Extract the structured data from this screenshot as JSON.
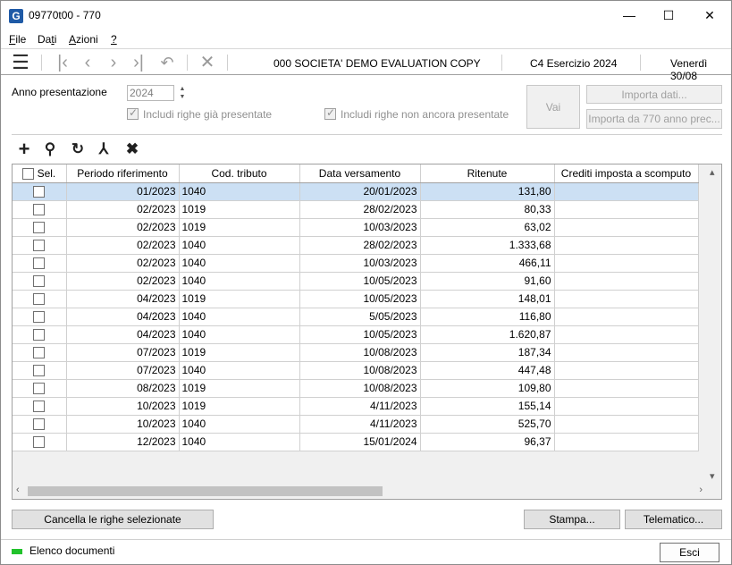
{
  "window": {
    "title": "09770t00 - 770",
    "app_icon_letter": "G",
    "controls": {
      "minimize": "—",
      "maximize": "☐",
      "close": "✕"
    }
  },
  "menu": {
    "items": [
      {
        "label": "File",
        "mnemonic": "F"
      },
      {
        "label": "Dati",
        "mnemonic": "t"
      },
      {
        "label": "Azioni",
        "mnemonic": "A"
      },
      {
        "label": "?",
        "mnemonic": "?"
      }
    ]
  },
  "toolbar": {
    "company": "000 SOCIETA'  DEMO EVALUATION COPY",
    "year": "C4 Esercizio 2024",
    "date": "Venerdì 30/08"
  },
  "form": {
    "anno_label": "Anno presentazione",
    "anno_value": "2024",
    "chk_gia_label": "Includi righe già presentate",
    "chk_non_label": "Includi righe non ancora presentate",
    "vai_label": "Vai",
    "importa_label": "Importa dati...",
    "importa770_label": "Importa da 770 anno prec..."
  },
  "grid": {
    "columns": [
      "Sel.",
      "Periodo riferimento",
      "Cod. tributo",
      "Data versamento",
      "Ritenute",
      "Crediti imposta a scomputo"
    ],
    "rows": [
      {
        "periodo": "01/2023",
        "tributo": "1040",
        "data": "20/01/2023",
        "ritenute": "131,80",
        "selected": true
      },
      {
        "periodo": "02/2023",
        "tributo": "1019",
        "data": "28/02/2023",
        "ritenute": "80,33"
      },
      {
        "periodo": "02/2023",
        "tributo": "1019",
        "data": "10/03/2023",
        "ritenute": "63,02"
      },
      {
        "periodo": "02/2023",
        "tributo": "1040",
        "data": "28/02/2023",
        "ritenute": "1.333,68"
      },
      {
        "periodo": "02/2023",
        "tributo": "1040",
        "data": "10/03/2023",
        "ritenute": "466,11"
      },
      {
        "periodo": "02/2023",
        "tributo": "1040",
        "data": "10/05/2023",
        "ritenute": "91,60"
      },
      {
        "periodo": "04/2023",
        "tributo": "1019",
        "data": "10/05/2023",
        "ritenute": "148,01"
      },
      {
        "periodo": "04/2023",
        "tributo": "1040",
        "data": "5/05/2023",
        "ritenute": "116,80"
      },
      {
        "periodo": "04/2023",
        "tributo": "1040",
        "data": "10/05/2023",
        "ritenute": "1.620,87"
      },
      {
        "periodo": "07/2023",
        "tributo": "1019",
        "data": "10/08/2023",
        "ritenute": "187,34"
      },
      {
        "periodo": "07/2023",
        "tributo": "1040",
        "data": "10/08/2023",
        "ritenute": "447,48"
      },
      {
        "periodo": "08/2023",
        "tributo": "1019",
        "data": "10/08/2023",
        "ritenute": "109,80"
      },
      {
        "periodo": "10/2023",
        "tributo": "1019",
        "data": "4/11/2023",
        "ritenute": "155,14"
      },
      {
        "periodo": "10/2023",
        "tributo": "1040",
        "data": "4/11/2023",
        "ritenute": "525,70"
      },
      {
        "periodo": "12/2023",
        "tributo": "1040",
        "data": "15/01/2024",
        "ritenute": "96,37"
      }
    ]
  },
  "actions": {
    "cancella_label": "Cancella le righe selezionate",
    "stampa_label": "Stampa...",
    "telematico_label": "Telematico...",
    "esci_label": "Esci"
  },
  "status": {
    "text": "Elenco documenti",
    "led_color": "#22c22c"
  },
  "accent_color": "#cce0f4"
}
